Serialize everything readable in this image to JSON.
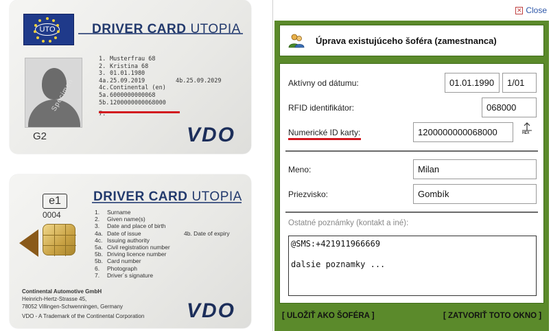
{
  "front_card": {
    "flag_code": "UTO",
    "title": "DRIVER CARD",
    "subtitle": "UTOPIA",
    "generation": "G2",
    "photo_watermark": "Specimen",
    "fields": [
      {
        "num": "1.",
        "value": "Musterfrau 68"
      },
      {
        "num": "2.",
        "value": "Kristina 68"
      },
      {
        "num": "3.",
        "value": "01.01.1980"
      },
      {
        "num": "4a.",
        "value": "25.09.2019"
      },
      {
        "num": "4c.",
        "value": "Continental (en)"
      },
      {
        "num": "5a.",
        "value": "6000000000068"
      },
      {
        "num": "5b.",
        "value": "1200000000068000"
      },
      {
        "num": "7.",
        "value": ""
      }
    ],
    "expiry": "4b.25.09.2029",
    "brand": "VDO"
  },
  "back_card": {
    "country_code": "e1",
    "number": "0004",
    "title": "DRIVER CARD",
    "subtitle": "UTOPIA",
    "legend": [
      {
        "num": "1.",
        "label": "Surname"
      },
      {
        "num": "2.",
        "label": "Given name(s)"
      },
      {
        "num": "3.",
        "label": "Date and place of birth"
      },
      {
        "num": "4a.",
        "label": "Date of issue"
      },
      {
        "num": "4c.",
        "label": "Issuing authority"
      },
      {
        "num": "5a.",
        "label": "Civil registration number"
      },
      {
        "num": "5b.",
        "label": "Driving licence number"
      },
      {
        "num": "5b.",
        "label": "Card number"
      },
      {
        "num": "6.",
        "label": "Photograph"
      },
      {
        "num": "7.",
        "label": "Driver´s signature"
      }
    ],
    "legend_expiry": "4b.  Date of expiry",
    "manufacturer": {
      "name": "Continental Automotive GmbH",
      "street": "Heinrich-Hertz-Strasse 45,",
      "city": "78052 Villingen-Schwenningen, Germany",
      "trademark": "VDO - A Trademark of the Continental Corporation"
    },
    "brand": "VDO"
  },
  "dialog": {
    "close_label": "Close",
    "title": "Úprava existujúceho šoféra (zamestnanca)",
    "active_from_label": "Aktívny od dátumu:",
    "active_from_date": "01.01.1990",
    "active_from_time": "1/01",
    "rfid_label": "RFID identifikátor:",
    "rfid_value": "068000",
    "numeric_id_label": "Numerické ID karty:",
    "numeric_id_value": "1200000000068000",
    "hex_label": "HEX",
    "first_name_label": "Meno:",
    "first_name_value": "Milan",
    "last_name_label": "Priezvisko:",
    "last_name_value": "Gombík",
    "notes_label": "Ostatné poznámky (kontakt a iné):",
    "notes_value": "@SMS:+421911966669\n\ndalsie poznamky ...",
    "save_button": "[ ULOŽIŤ AKO ŠOFÉRA ]",
    "close_button": "[ ZATVORIŤ TOTO OKNO ]"
  },
  "colors": {
    "accent_green": "#5b8a2b",
    "highlight_red": "#d2161e",
    "card_navy": "#233a6d",
    "link_blue": "#2c56a8"
  }
}
